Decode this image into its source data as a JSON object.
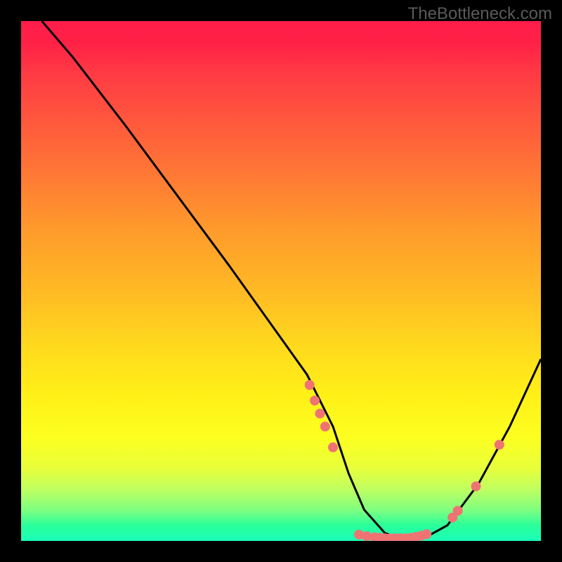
{
  "watermark": "TheBottleneck.com",
  "chart_data": {
    "type": "line",
    "title": "",
    "xlabel": "",
    "ylabel": "",
    "xlim": [
      0,
      100
    ],
    "ylim": [
      0,
      100
    ],
    "series": [
      {
        "name": "curve",
        "x": [
          4,
          10,
          20,
          30,
          40,
          50,
          55,
          60,
          63,
          66,
          70,
          74,
          78,
          82,
          88,
          94,
          100
        ],
        "y": [
          100,
          93,
          80,
          66.5,
          53,
          39,
          32,
          22,
          13,
          6,
          1.5,
          0.2,
          0.8,
          3,
          11,
          22,
          35
        ]
      }
    ],
    "markers": [
      {
        "x": 55.5,
        "y": 30
      },
      {
        "x": 56.5,
        "y": 27
      },
      {
        "x": 57.5,
        "y": 24.5
      },
      {
        "x": 58.5,
        "y": 22
      },
      {
        "x": 60,
        "y": 18
      },
      {
        "x": 65,
        "y": 1.2
      },
      {
        "x": 66.5,
        "y": 0.9
      },
      {
        "x": 68,
        "y": 0.7
      },
      {
        "x": 69,
        "y": 0.6
      },
      {
        "x": 70,
        "y": 0.5
      },
      {
        "x": 71,
        "y": 0.5
      },
      {
        "x": 72,
        "y": 0.5
      },
      {
        "x": 73,
        "y": 0.5
      },
      {
        "x": 74,
        "y": 0.5
      },
      {
        "x": 75,
        "y": 0.6
      },
      {
        "x": 76,
        "y": 0.8
      },
      {
        "x": 77,
        "y": 1.0
      },
      {
        "x": 78,
        "y": 1.3
      },
      {
        "x": 83,
        "y": 4.5
      },
      {
        "x": 84,
        "y": 5.8
      },
      {
        "x": 87.5,
        "y": 10.5
      },
      {
        "x": 92,
        "y": 18.5
      }
    ],
    "colors": {
      "curve": "#000000",
      "marker": "#ef7373"
    }
  }
}
